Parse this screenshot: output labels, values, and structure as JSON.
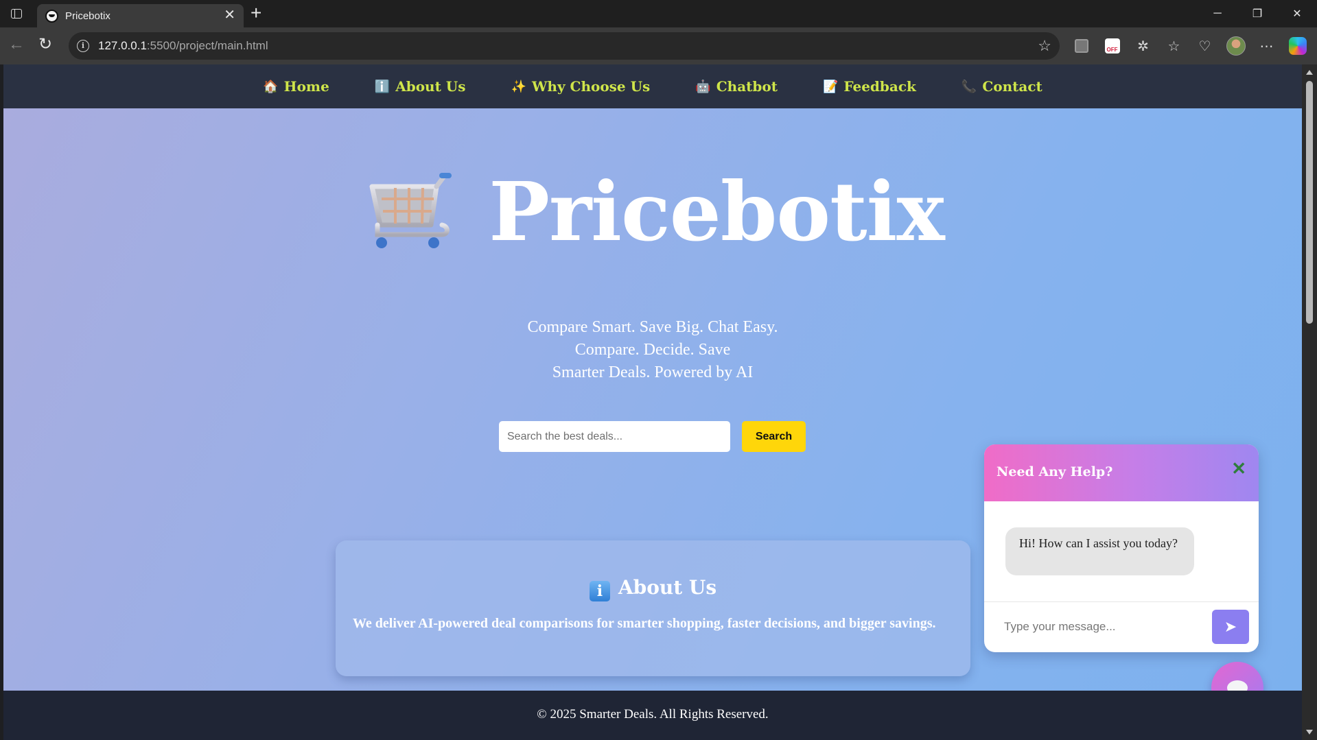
{
  "browser": {
    "tab_title": "Pricebotix",
    "new_tab_label": "+",
    "url_host": "127.0.0.1",
    "url_rest": ":5500/project/main.html",
    "ext_off_label": "OFF"
  },
  "nav": {
    "items": [
      {
        "emoji": "🏠",
        "label": "Home"
      },
      {
        "emoji": "ℹ️",
        "label": "About Us"
      },
      {
        "emoji": "✨",
        "label": "Why Choose Us"
      },
      {
        "emoji": "🤖",
        "label": "Chatbot"
      },
      {
        "emoji": "📝",
        "label": "Feedback"
      },
      {
        "emoji": "📞",
        "label": "Contact"
      }
    ],
    "link_color": "#cfe54a"
  },
  "hero": {
    "brand": "Pricebotix",
    "taglines": [
      "Compare Smart. Save Big. Chat Easy.",
      "Compare. Decide. Save",
      "Smarter Deals. Powered by AI"
    ]
  },
  "search": {
    "placeholder": "Search the best deals...",
    "button_label": "Search",
    "button_color": "#ffd60a"
  },
  "about": {
    "icon": "i",
    "title": "About Us",
    "text": "We deliver AI-powered deal comparisons for smarter shopping, faster decisions, and bigger savings."
  },
  "chat": {
    "header_title": "Need Any Help?",
    "close_glyph": "✕",
    "bot_message": "Hi! How can I assist you today?",
    "input_placeholder": "Type your message...",
    "send_glyph": "➤"
  },
  "footer": {
    "text": "© 2025 Smarter Deals. All Rights Reserved."
  }
}
